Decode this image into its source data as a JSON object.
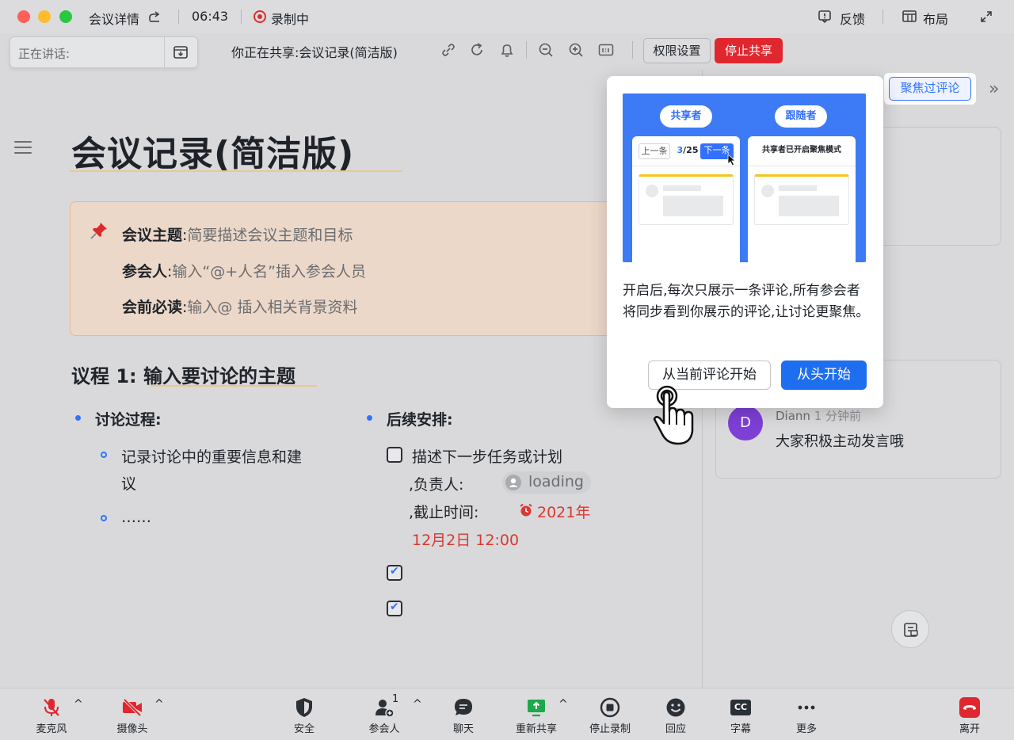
{
  "window": {
    "title": "会议详情",
    "time": "06:43",
    "recording_label": "录制中",
    "feedback_label": "反馈",
    "layout_label": "布局"
  },
  "share_bar": {
    "speaking_label": "正在讲话:",
    "sharing_text": "你正在共享:会议记录(简洁版)",
    "permission_button": "权限设置",
    "stop_share_button": "停止共享"
  },
  "document": {
    "title": "会议记录(简洁版)",
    "callout": [
      {
        "key": "会议主题",
        "sep": ":",
        "value": "简要描述会议主题和目标"
      },
      {
        "key": "参会人",
        "sep": ":",
        "value": "输入“@+人名”插入参会人员"
      },
      {
        "key": "会前必读",
        "sep": ":",
        "value": "输入@ 插入相关背景资料"
      }
    ],
    "agenda_prefix": "议程 1:",
    "agenda_title": "输入要讨论的主题",
    "discussion_heading": "讨论过程:",
    "discussion_item1_line1": "记录讨论中的重要信息和建",
    "discussion_item1_line2": "议",
    "discussion_item2": "……",
    "followup_heading": "后续安排:",
    "task_line1": "描述下一步任务或计划",
    "task_owner_label": ",负责人:",
    "task_owner_value": "loading",
    "task_deadline_label": ",截止时间:",
    "task_deadline_part1": "2021年",
    "task_deadline_part2": "12月2日 12:00",
    "checkbox_states": [
      false,
      true,
      true
    ]
  },
  "comments_panel": {
    "focus_button": "聚焦过评论",
    "comment": {
      "avatar_letter": "D",
      "author": "Diann",
      "time": "1 分钟前",
      "text": "大家积极主动发言哦"
    }
  },
  "popup": {
    "sharer_label": "共享者",
    "follower_label": "跟随者",
    "prev_label": "上一条",
    "counter_current": "3",
    "counter_total": "/25",
    "next_label": "下一条",
    "follower_status": "共享者已开启聚焦模式",
    "description": "开启后,每次只展示一条评论,所有参会者将同步看到你展示的评论,让讨论更聚焦。",
    "from_current_button": "从当前评论开始",
    "from_start_button": "从头开始"
  },
  "bottom_bar": {
    "mic": "麦克风",
    "camera": "摄像头",
    "security": "安全",
    "participants": "参会人",
    "participants_count": "1",
    "chat": "聊天",
    "reshare": "重新共享",
    "stop_recording": "停止录制",
    "reaction": "回应",
    "captions": "字幕",
    "captions_icon_text": "CC",
    "more": "更多",
    "leave": "离开"
  },
  "colors": {
    "accent": "#3370ff",
    "danger": "#e0272f",
    "reshare_green": "#1ba94c",
    "avatar_purple": "#7d3fd6"
  }
}
